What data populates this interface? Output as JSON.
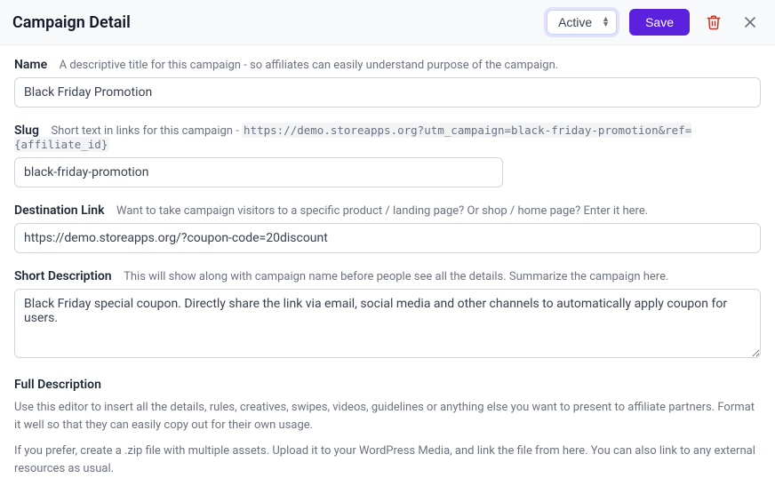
{
  "header": {
    "title": "Campaign Detail",
    "status_value": "Active",
    "save_label": "Save"
  },
  "fields": {
    "name": {
      "label": "Name",
      "hint": "A descriptive title for this campaign - so affiliates can easily understand purpose of the campaign.",
      "value": "Black Friday Promotion"
    },
    "slug": {
      "label": "Slug",
      "hint_prefix": "Short text in links for this campaign - ",
      "hint_code": "https://demo.storeapps.org?utm_campaign=black-friday-promotion&ref={affiliate_id}",
      "value": "black-friday-promotion"
    },
    "destination": {
      "label": "Destination Link",
      "hint": "Want to take campaign visitors to a specific product / landing page? Or shop / home page? Enter it here.",
      "value": "https://demo.storeapps.org/?coupon-code=20discount"
    },
    "short_desc": {
      "label": "Short Description",
      "hint": "This will show along with campaign name before people see all the details. Summarize the campaign here.",
      "value": "Black Friday special coupon. Directly share the link via email, social media and other channels to automatically apply coupon for users."
    },
    "full_desc": {
      "label": "Full Description",
      "p1": "Use this editor to insert all the details, rules, creatives, swipes, videos, guidelines or anything else you want to present to affiliate partners. Format it well so that they can easily copy out for their own usage.",
      "p2": "If you prefer, create a .zip file with multiple assets. Upload it to your WordPress Media, and link the file from here. You can also link to any external resources as usual."
    }
  }
}
